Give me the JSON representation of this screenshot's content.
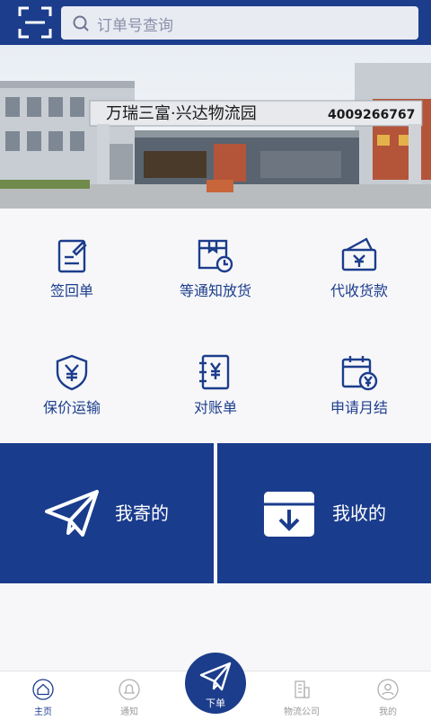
{
  "search": {
    "placeholder": "订单号查询"
  },
  "banner": {
    "sign_text": "万瑞三富·兴达物流园",
    "phone": "4009266767"
  },
  "functions": [
    {
      "label": "签回单",
      "icon": "signed-receipt-icon"
    },
    {
      "label": "等通知放货",
      "icon": "box-clock-icon"
    },
    {
      "label": "代收货款",
      "icon": "wallet-yuan-icon"
    },
    {
      "label": "保价运输",
      "icon": "shield-yuan-icon"
    },
    {
      "label": "对账单",
      "icon": "notebook-yuan-icon"
    },
    {
      "label": "申请月结",
      "icon": "calendar-yuan-icon"
    }
  ],
  "tiles": [
    {
      "label": "我寄的",
      "icon": "paper-plane-icon"
    },
    {
      "label": "我收的",
      "icon": "box-download-icon"
    }
  ],
  "tabbar": {
    "home": "主页",
    "notify": "通知",
    "order": "下单",
    "logistics": "物流公司",
    "mine": "我的"
  },
  "colors": {
    "primary": "#1c3d8c",
    "tile": "#1a3c8d",
    "background": "#f7f7f9"
  }
}
